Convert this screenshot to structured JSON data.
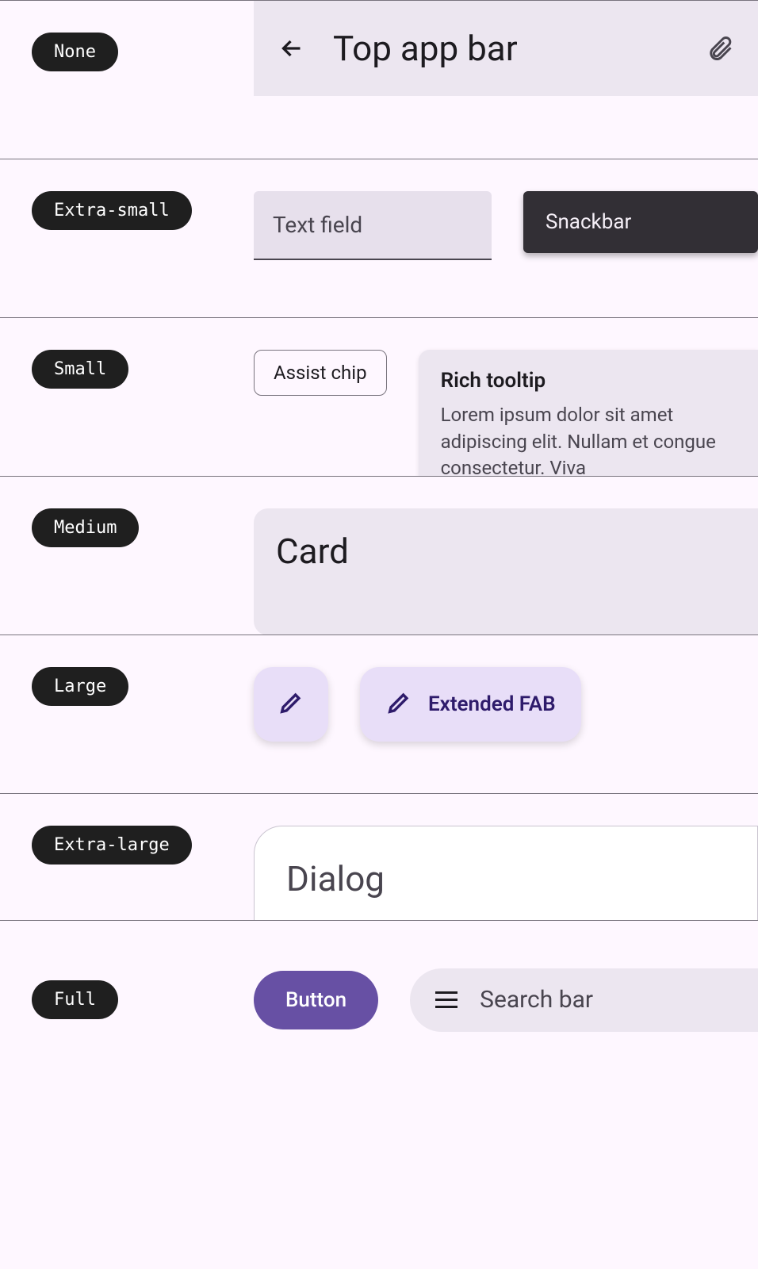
{
  "rows": {
    "none": {
      "label": "None",
      "appbar": {
        "title": "Top app bar"
      }
    },
    "xsmall": {
      "label": "Extra-small",
      "textfield": {
        "label": "Text field"
      },
      "snackbar": {
        "label": "Snackbar"
      }
    },
    "small": {
      "label": "Small",
      "chip": {
        "label": "Assist chip"
      },
      "tooltip": {
        "title": "Rich tooltip",
        "body": "Lorem ipsum dolor sit amet adipiscing elit. Nullam et congue consectetur. Viva"
      }
    },
    "medium": {
      "label": "Medium",
      "card": {
        "title": "Card"
      }
    },
    "large": {
      "label": "Large",
      "extfab": {
        "label": "Extended FAB"
      }
    },
    "xlarge": {
      "label": "Extra-large",
      "dialog": {
        "title": "Dialog"
      }
    },
    "full": {
      "label": "Full",
      "button": {
        "label": "Button"
      },
      "search": {
        "placeholder": "Search bar"
      }
    }
  }
}
